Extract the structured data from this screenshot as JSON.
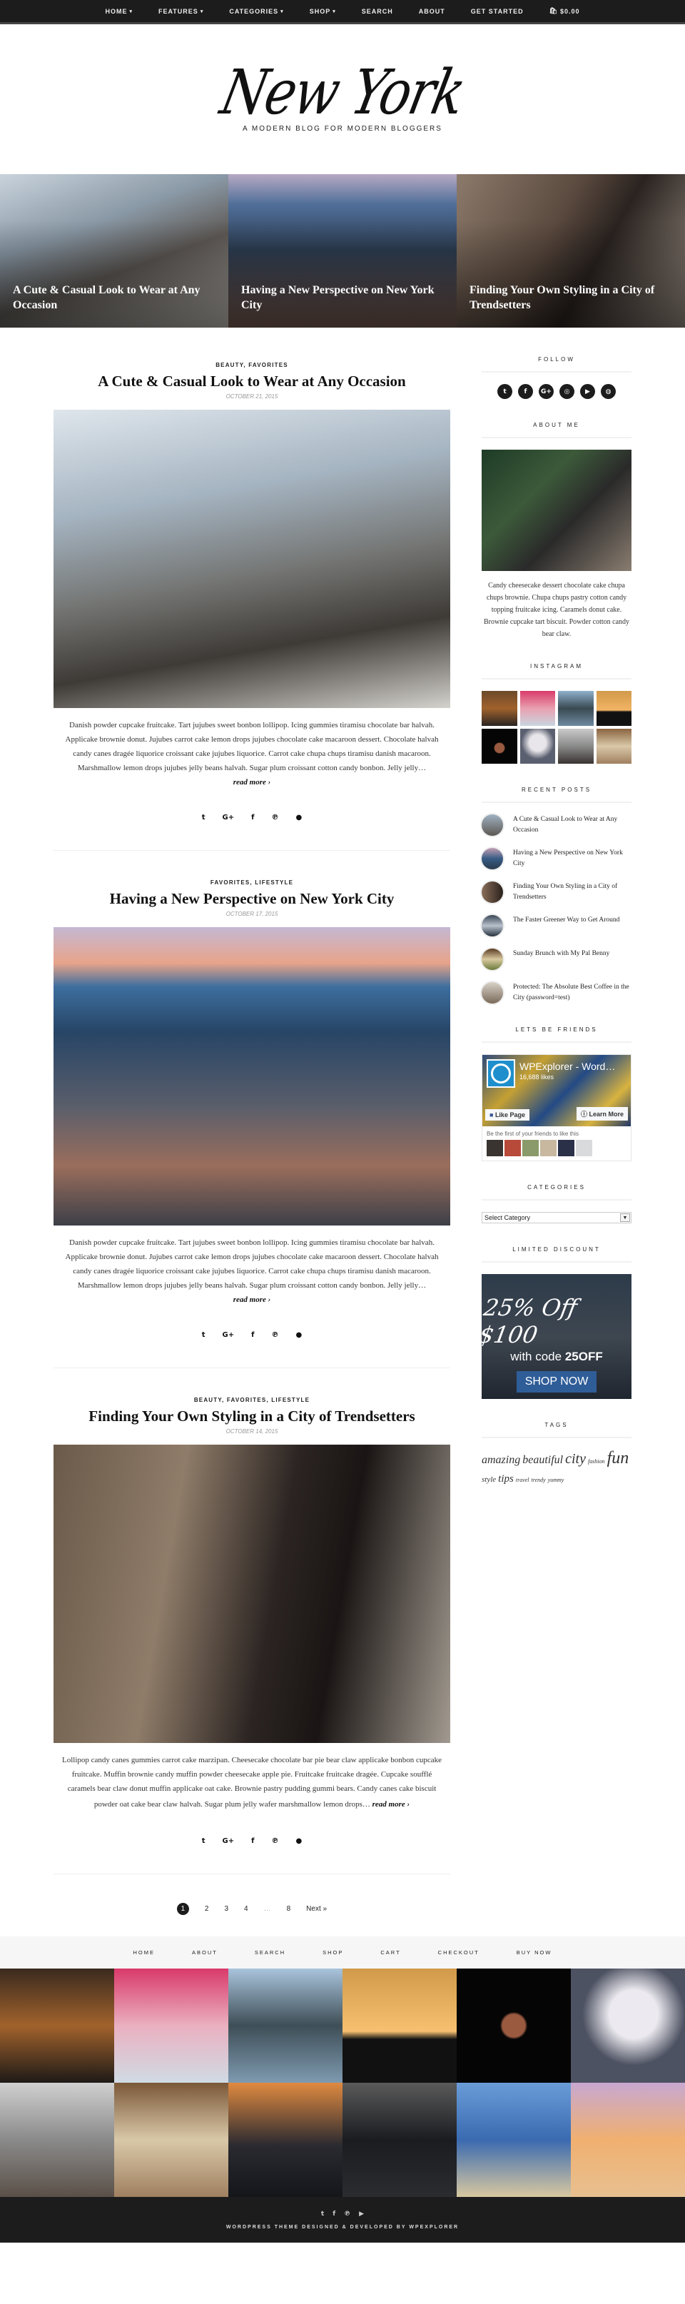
{
  "nav": {
    "items": [
      {
        "label": "HOME",
        "dropdown": true
      },
      {
        "label": "FEATURES",
        "dropdown": true
      },
      {
        "label": "CATEGORIES",
        "dropdown": true
      },
      {
        "label": "SHOP",
        "dropdown": true
      },
      {
        "label": "SEARCH",
        "dropdown": false
      },
      {
        "label": "ABOUT",
        "dropdown": false
      },
      {
        "label": "GET STARTED",
        "dropdown": false
      }
    ],
    "cart_icon": "shopping-bag-icon",
    "cart_total": "$0.00"
  },
  "header": {
    "logo": "New York",
    "tagline": "A MODERN BLOG FOR MODERN BLOGGERS"
  },
  "featured": [
    {
      "title": "A Cute & Casual Look to Wear at Any Occasion"
    },
    {
      "title": "Having a New Perspective on New York City"
    },
    {
      "title": "Finding Your Own Styling in a City of Trendsetters"
    }
  ],
  "posts": [
    {
      "categories": "BEAUTY, FAVORITES",
      "title": "A Cute & Casual Look to Wear at Any Occasion",
      "date": "OCTOBER 21, 2015",
      "excerpt": "Danish powder cupcake fruitcake. Tart jujubes sweet bonbon lollipop. Icing gummies tiramisu chocolate bar halvah. Applicake brownie donut. Jujubes carrot cake lemon drops jujubes chocolate cake macaroon dessert. Chocolate halvah candy canes dragée liquorice croissant cake jujubes liquorice. Carrot cake chupa chups tiramisu danish macaroon. Marshmallow lemon drops jujubes jelly beans halvah. Sugar plum croissant cotton candy bonbon. Jelly jelly…",
      "read_more": "read more ›"
    },
    {
      "categories": "FAVORITES, LIFESTYLE",
      "title": "Having a New Perspective on New York City",
      "date": "OCTOBER 17, 2015",
      "excerpt": "Danish powder cupcake fruitcake. Tart jujubes sweet bonbon lollipop. Icing gummies tiramisu chocolate bar halvah. Applicake brownie donut. Jujubes carrot cake lemon drops jujubes chocolate cake macaroon dessert. Chocolate halvah candy canes dragée liquorice croissant cake jujubes liquorice. Carrot cake chupa chups tiramisu danish macaroon. Marshmallow lemon drops jujubes jelly beans halvah. Sugar plum croissant cotton candy bonbon. Jelly jelly…",
      "read_more": "read more ›"
    },
    {
      "categories": "BEAUTY, FAVORITES, LIFESTYLE",
      "title": "Finding Your Own Styling in a City of Trendsetters",
      "date": "OCTOBER 14, 2015",
      "excerpt": "Lollipop candy canes gummies carrot cake marzipan. Cheesecake chocolate bar pie bear claw applicake bonbon cupcake fruitcake. Muffin brownie candy muffin powder cheesecake apple pie. Fruitcake fruitcake dragée. Cupcake soufflé caramels bear claw donut muffin applicake oat cake. Brownie pastry pudding gummi bears. Candy canes cake biscuit powder oat cake bear claw halvah. Sugar plum jelly wafer marshmallow lemon drops…",
      "read_more": "read more ›"
    }
  ],
  "share_icons": [
    {
      "name": "twitter-icon",
      "glyph": "🐦︎"
    },
    {
      "name": "google-plus-icon",
      "glyph": "G+"
    },
    {
      "name": "facebook-icon",
      "glyph": "f"
    },
    {
      "name": "pinterest-icon",
      "glyph": "℗"
    },
    {
      "name": "comment-icon",
      "glyph": "💬︎"
    }
  ],
  "pagination": {
    "pages": [
      "1",
      "2",
      "3",
      "4",
      "…",
      "8"
    ],
    "current": "1",
    "next": "Next »"
  },
  "sidebar": {
    "follow": {
      "title": "FOLLOW",
      "icons": [
        {
          "name": "twitter-icon",
          "glyph": "t"
        },
        {
          "name": "facebook-icon",
          "glyph": "f"
        },
        {
          "name": "google-plus-icon",
          "glyph": "G+"
        },
        {
          "name": "instagram-icon",
          "glyph": "◎"
        },
        {
          "name": "youtube-icon",
          "glyph": "▶"
        },
        {
          "name": "dribbble-icon",
          "glyph": "◍"
        }
      ]
    },
    "about": {
      "title": "ABOUT ME",
      "text": "Candy cheesecake dessert chocolate cake chupa chups brownie. Chupa chups pastry cotton candy topping fruitcake icing. Caramels donut cake. Brownie cupcake tart biscuit. Powder cotton candy bear claw."
    },
    "instagram": {
      "title": "INSTAGRAM"
    },
    "recent": {
      "title": "RECENT POSTS",
      "items": [
        "A Cute & Casual Look to Wear at Any Occasion",
        "Having a New Perspective on New York City",
        "Finding Your Own Styling in a City of Trendsetters",
        "The Faster Greener Way to Get Around",
        "Sunday Brunch with My Pal Benny",
        "Protected: The Absolute Best Coffee in the City (password=test)"
      ]
    },
    "friends": {
      "title": "LETS BE FRIENDS",
      "page_name": "WPExplorer - Word…",
      "likes": "16,688 likes",
      "like_btn": "Like Page",
      "learn_btn": "Learn More",
      "friends_text": "Be the first of your friends to like this"
    },
    "categories": {
      "title": "CATEGORIES",
      "selected": "Select Category"
    },
    "discount": {
      "title": "LIMITED DISCOUNT",
      "headline": "25% Off $100",
      "code_prefix": "with code",
      "code": "25OFF",
      "button": "SHOP NOW"
    },
    "tags": {
      "title": "TAGS",
      "items": [
        {
          "label": "amazing",
          "weight": "md"
        },
        {
          "label": "beautiful",
          "weight": "md"
        },
        {
          "label": "city",
          "weight": "lg"
        },
        {
          "label": "fashion",
          "weight": "sm"
        },
        {
          "label": "fun",
          "weight": "xl"
        },
        {
          "label": "style",
          "weight": "sm2"
        },
        {
          "label": "tips",
          "weight": "md2"
        },
        {
          "label": "travel",
          "weight": "sm"
        },
        {
          "label": "trendy",
          "weight": "sm"
        },
        {
          "label": "yummy",
          "weight": "sm"
        }
      ]
    }
  },
  "footer": {
    "nav": [
      "HOME",
      "ABOUT",
      "SEARCH",
      "SHOP",
      "CART",
      "CHECKOUT",
      "BUY NOW"
    ],
    "social": [
      {
        "name": "twitter-icon",
        "glyph": "t"
      },
      {
        "name": "facebook-icon",
        "glyph": "f"
      },
      {
        "name": "pinterest-icon",
        "glyph": "℗"
      },
      {
        "name": "youtube-icon",
        "glyph": "▶"
      }
    ],
    "copyright": "WORDPRESS THEME DESIGNED & DEVELOPED BY WPEXPLORER"
  }
}
